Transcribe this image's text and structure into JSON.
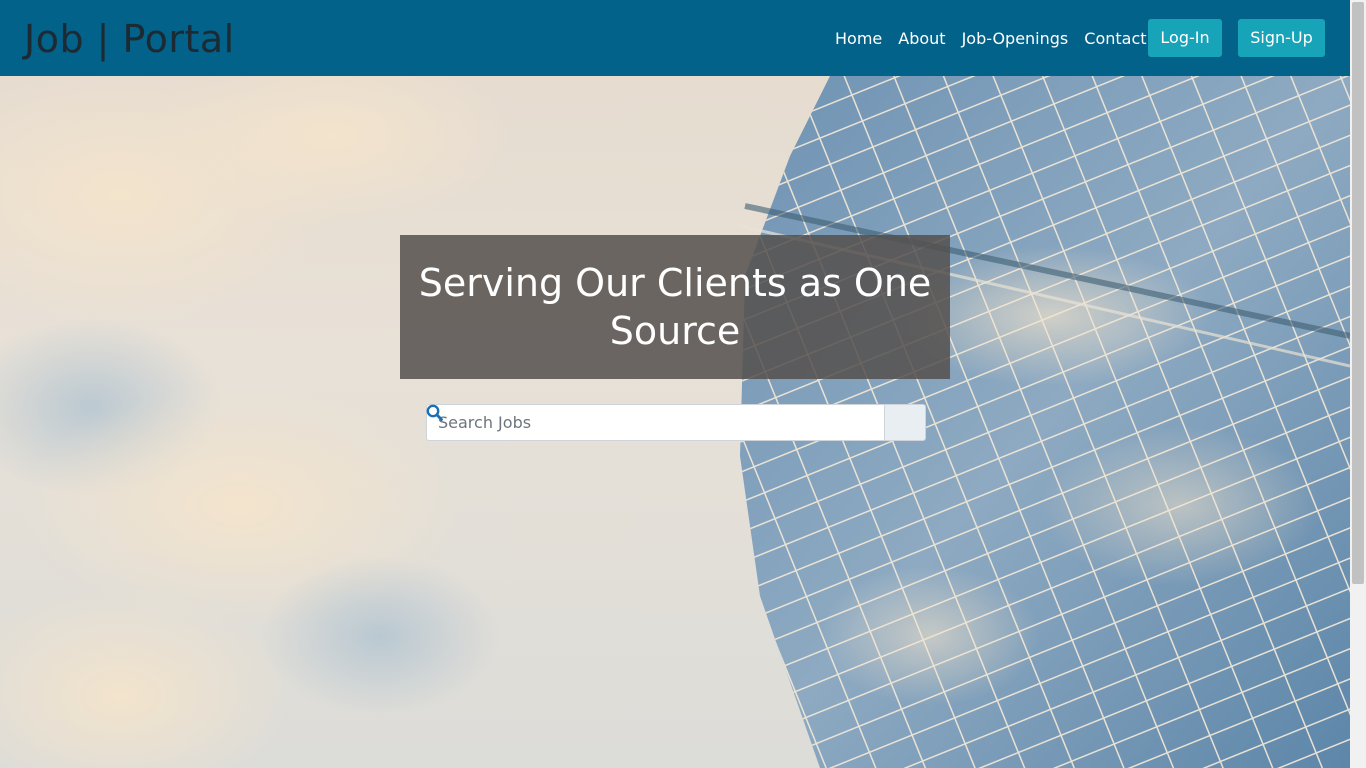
{
  "navbar": {
    "brand": "Job | Portal",
    "links": [
      "Home",
      "About",
      "Job-Openings",
      "Contact"
    ],
    "login_label": "Log-In",
    "signup_label": "Sign-Up",
    "background_color": "#03628a",
    "button_color": "#18a4b8"
  },
  "hero": {
    "headline": "Serving Our Clients as One Source",
    "search": {
      "placeholder": "Search Jobs",
      "value": "",
      "button_icon": "search-icon"
    },
    "background_image": "skyscraper glass facade with clouds"
  }
}
